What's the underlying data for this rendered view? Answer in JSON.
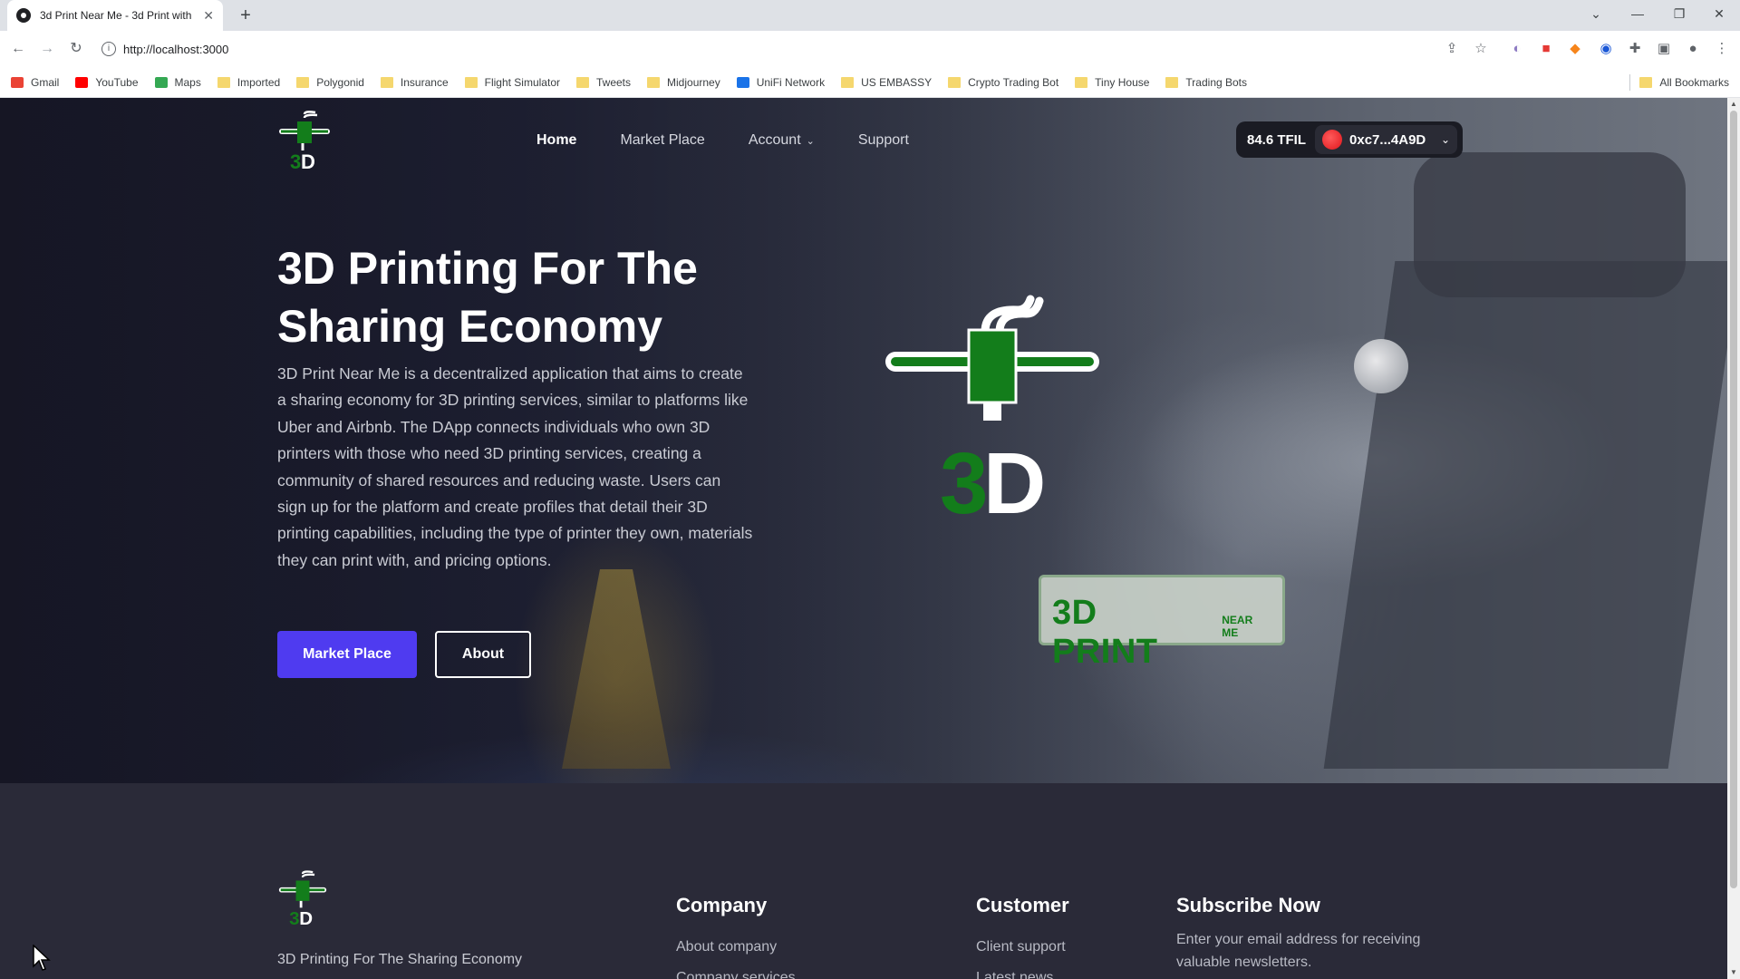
{
  "browser": {
    "tab_title": "3d Print Near Me - 3d Print with",
    "tab_close": "✕",
    "new_tab": "+",
    "url": "http://localhost:3000",
    "window_controls": [
      "⌄",
      "—",
      "❐",
      "✕"
    ],
    "bookmarks": [
      {
        "label": "Gmail",
        "icon": "gmail-icon",
        "color": "#ea4335"
      },
      {
        "label": "YouTube",
        "icon": "youtube-icon",
        "color": "#ff0000"
      },
      {
        "label": "Maps",
        "icon": "maps-icon",
        "color": "#34a853"
      },
      {
        "label": "Imported",
        "icon": "folder-icon"
      },
      {
        "label": "Polygonid",
        "icon": "folder-icon"
      },
      {
        "label": "Insurance",
        "icon": "folder-icon"
      },
      {
        "label": "Flight Simulator",
        "icon": "folder-icon"
      },
      {
        "label": "Tweets",
        "icon": "folder-icon"
      },
      {
        "label": "Midjourney",
        "icon": "folder-icon"
      },
      {
        "label": "UniFi Network",
        "icon": "unifi-icon",
        "color": "#1a73e8"
      },
      {
        "label": "US EMBASSY",
        "icon": "folder-icon"
      },
      {
        "label": "Crypto Trading Bot",
        "icon": "folder-icon"
      },
      {
        "label": "Tiny House",
        "icon": "folder-icon"
      },
      {
        "label": "Trading Bots",
        "icon": "folder-icon"
      }
    ],
    "all_bookmarks": "All Bookmarks"
  },
  "nav": {
    "links": [
      "Home",
      "Market Place",
      "Account",
      "Support"
    ],
    "account_chevron": "⌄"
  },
  "wallet": {
    "balance": "84.6 TFIL",
    "address": "0xc7...4A9D",
    "chevron": "⌄"
  },
  "hero": {
    "title": "3D Printing For The Sharing Economy",
    "description": "3D Print Near Me is a decentralized application that aims to create a sharing economy for 3D printing services, similar to platforms like Uber and Airbnb. The DApp connects individuals who own 3D printers with those who need 3D printing services, creating a community of shared resources and reducing waste. Users can sign up for the platform and create profiles that detail their 3D printing capabilities, including the type of printer they own, materials they can print with, and pricing options.",
    "primary_button": "Market Place",
    "secondary_button": "About",
    "badge_big": "3D PRINT",
    "badge_small": "NEAR ME"
  },
  "footer": {
    "tagline": "3D Printing For The Sharing Economy",
    "company_heading": "Company",
    "company_links": [
      "About company",
      "Company services"
    ],
    "customer_heading": "Customer",
    "customer_links": [
      "Client support",
      "Latest news"
    ],
    "subscribe_heading": "Subscribe Now",
    "subscribe_text": "Enter your email address for receiving valuable newsletters."
  },
  "colors": {
    "brand_green": "#137d1b",
    "primary_button": "#4f3bf0",
    "footer_bg": "#2a2a38"
  }
}
